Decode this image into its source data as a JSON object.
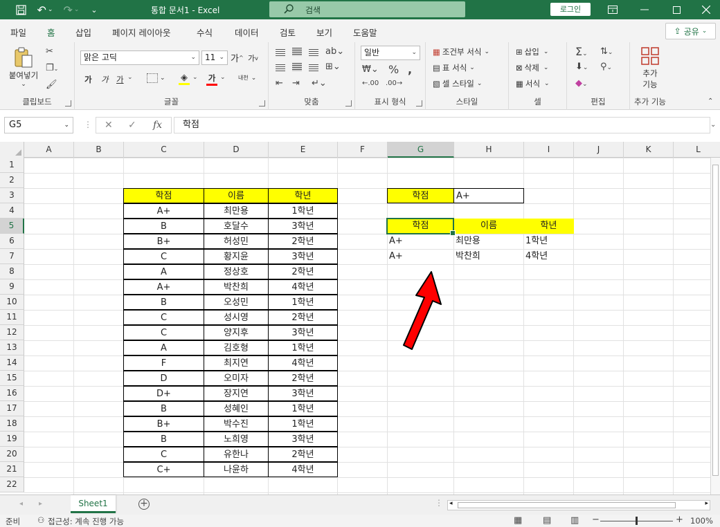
{
  "window": {
    "title": "통합 문서1  -  Excel",
    "search_placeholder": "검색",
    "login_label": "로그인"
  },
  "tabs": [
    "파일",
    "홈",
    "삽입",
    "페이지 레이아웃",
    "수식",
    "데이터",
    "검토",
    "보기",
    "도움말"
  ],
  "active_tab": "홈",
  "share_label": "공유",
  "ribbon": {
    "clipboard": {
      "label": "클립보드",
      "paste": "붙여넣기"
    },
    "font": {
      "label": "글꼴",
      "font_name": "맑은 고딕",
      "font_size": "11",
      "bold": "가",
      "italic": "가",
      "underline": "가",
      "grow": "가",
      "shrink": "가",
      "font_color": "가",
      "phonetic": "내천"
    },
    "alignment": {
      "label": "맞춤"
    },
    "number": {
      "label": "표시 형식",
      "format": "일반"
    },
    "styles": {
      "label": "스타일",
      "conditional": "조건부 서식",
      "table": "표 서식",
      "cell_style": "셀 스타일"
    },
    "cells": {
      "label": "셀",
      "insert": "삽입",
      "delete": "삭제",
      "format": "서식"
    },
    "editing": {
      "label": "편집"
    },
    "addins": {
      "label": "추가 기능",
      "button_line1": "추가",
      "button_line2": "기능"
    }
  },
  "formula_bar": {
    "name_box": "G5",
    "formula": "학점"
  },
  "columns": [
    "A",
    "B",
    "C",
    "D",
    "E",
    "F",
    "G",
    "H",
    "I",
    "J",
    "K",
    "L"
  ],
  "rows": [
    "1",
    "2",
    "3",
    "4",
    "5",
    "6",
    "7",
    "8",
    "9",
    "10",
    "11",
    "12",
    "13",
    "14",
    "15",
    "16",
    "17",
    "18",
    "19",
    "20",
    "21",
    "22"
  ],
  "selected_column": "G",
  "selected_row": "5",
  "main_table": {
    "headers": [
      "학점",
      "이름",
      "학년"
    ],
    "rows": [
      [
        "A+",
        "최만용",
        "1학년"
      ],
      [
        "B",
        "호달수",
        "3학년"
      ],
      [
        "B+",
        "허성민",
        "2학년"
      ],
      [
        "C",
        "황지윤",
        "3학년"
      ],
      [
        "A",
        "정상호",
        "2학년"
      ],
      [
        "A+",
        "박찬희",
        "4학년"
      ],
      [
        "B",
        "오성민",
        "1학년"
      ],
      [
        "C",
        "성시영",
        "2학년"
      ],
      [
        "C",
        "양지후",
        "3학년"
      ],
      [
        "A",
        "김호형",
        "1학년"
      ],
      [
        "F",
        "최지연",
        "4학년"
      ],
      [
        "D",
        "오미자",
        "2학년"
      ],
      [
        "D+",
        "장지연",
        "3학년"
      ],
      [
        "B",
        "성혜인",
        "1학년"
      ],
      [
        "B+",
        "박수진",
        "1학년"
      ],
      [
        "B",
        "노희영",
        "3학년"
      ],
      [
        "C",
        "유한나",
        "2학년"
      ],
      [
        "C+",
        "나윤하",
        "4학년"
      ]
    ]
  },
  "criteria": {
    "label": "학점",
    "value": "A+"
  },
  "result_table": {
    "headers": [
      "학점",
      "이름",
      "학년"
    ],
    "rows": [
      [
        "A+",
        "최만용",
        "1학년"
      ],
      [
        "A+",
        "박찬희",
        "4학년"
      ]
    ]
  },
  "sheet_tab": "Sheet1",
  "status": {
    "ready": "준비",
    "accessibility": "접근성: 계속 진행 가능",
    "zoom": "100%"
  },
  "colors": {
    "excel_green": "#217346",
    "header_fill": "#ffff00",
    "arrow": "#ff0000"
  }
}
